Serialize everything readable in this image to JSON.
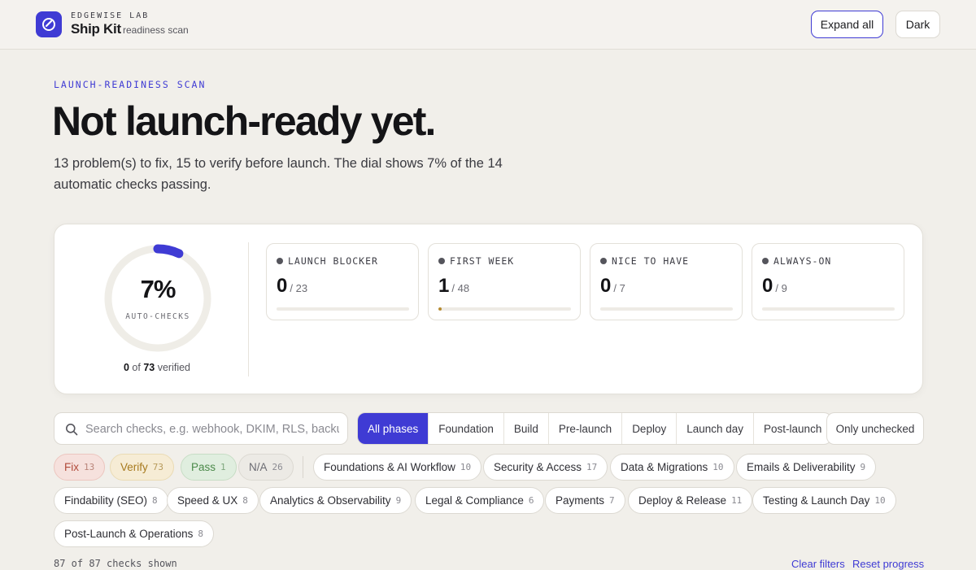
{
  "header": {
    "kicker": "EDGEWISE LAB",
    "name": "Ship Kit",
    "sub": "readiness scan",
    "expand_label": "Expand all",
    "dark_label": "Dark",
    "accent": "#3f3bd4"
  },
  "hero": {
    "kicker": "LAUNCH-READINESS SCAN",
    "title": "Not launch-ready yet.",
    "summary": "13 problem(s) to fix, 15 to verify before launch. The dial shows 7% of the 14 automatic checks passing."
  },
  "dial": {
    "percent_label": "7%",
    "percent": 7,
    "label": "AUTO-CHECKS",
    "verified_count": "0",
    "verified_of": "of",
    "verified_total": "73",
    "verified_suffix": "verified"
  },
  "stats": [
    {
      "title": "LAUNCH BLOCKER",
      "value": "0",
      "total": "/ 23",
      "fraction": 0
    },
    {
      "title": "FIRST WEEK",
      "value": "1",
      "total": "/ 48",
      "fraction": 0.021
    },
    {
      "title": "NICE TO HAVE",
      "value": "0",
      "total": "/ 7",
      "fraction": 0
    },
    {
      "title": "ALWAYS-ON",
      "value": "0",
      "total": "/ 9",
      "fraction": 0
    }
  ],
  "search": {
    "placeholder": "Search checks, e.g. webhook, DKIM, RLS, backups"
  },
  "phases": [
    "All phases",
    "Foundation",
    "Build",
    "Pre-launch",
    "Deploy",
    "Launch day",
    "Post-launch"
  ],
  "active_phase": "All phases",
  "only_unchecked_label": "Only unchecked",
  "status_filters": [
    {
      "label": "Fix",
      "count": "13",
      "status_color": "#b14a3a"
    },
    {
      "label": "Verify",
      "count": "73",
      "status_color": "#a77a1e"
    },
    {
      "label": "Pass",
      "count": "1",
      "status_color": "#4b8a4a"
    },
    {
      "label": "N/A",
      "count": "26",
      "status_color": "#6b6b72"
    }
  ],
  "categories": [
    {
      "label": "Foundations & AI Workflow",
      "count": "10"
    },
    {
      "label": "Security & Access",
      "count": "17"
    },
    {
      "label": "Data & Migrations",
      "count": "10"
    },
    {
      "label": "Emails & Deliverability",
      "count": "9"
    },
    {
      "label": "Findability (SEO)",
      "count": "8"
    },
    {
      "label": "Speed & UX",
      "count": "8"
    },
    {
      "label": "Analytics & Observability",
      "count": "9"
    },
    {
      "label": "Legal & Compliance",
      "count": "6"
    },
    {
      "label": "Payments",
      "count": "7"
    },
    {
      "label": "Deploy & Release",
      "count": "11"
    },
    {
      "label": "Testing & Launch Day",
      "count": "10"
    },
    {
      "label": "Post-Launch & Operations",
      "count": "8"
    }
  ],
  "footer": {
    "shown": "87 of 87 checks shown",
    "clear_filters": "Clear filters",
    "reset_progress": "Reset progress"
  }
}
